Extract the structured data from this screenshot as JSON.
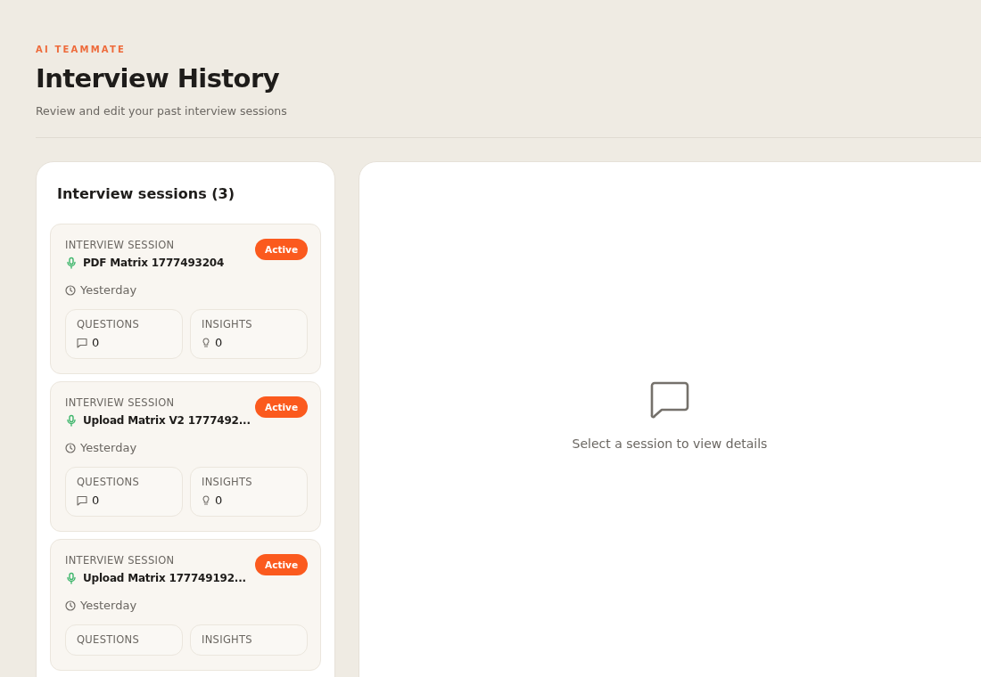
{
  "header": {
    "eyebrow": "AI TEAMMATE",
    "title": "Interview History",
    "subtitle": "Review and edit your past interview sessions"
  },
  "sessions_panel": {
    "heading": "Interview sessions (3)",
    "sessions": [
      {
        "label": "INTERVIEW SESSION",
        "title": "PDF Matrix 1777493204",
        "time": "Yesterday",
        "status": "Active",
        "stats": [
          {
            "kind": "questions",
            "label": "QUESTIONS",
            "value": "0"
          },
          {
            "kind": "insights",
            "label": "INSIGHTS",
            "value": "0"
          }
        ]
      },
      {
        "label": "INTERVIEW SESSION",
        "title": "Upload Matrix V2 1777492...",
        "time": "Yesterday",
        "status": "Active",
        "stats": [
          {
            "kind": "questions",
            "label": "QUESTIONS",
            "value": "0"
          },
          {
            "kind": "insights",
            "label": "INSIGHTS",
            "value": "0"
          }
        ]
      },
      {
        "label": "INTERVIEW SESSION",
        "title": "Upload Matrix 177749192...",
        "time": "Yesterday",
        "status": "Active",
        "stats": [
          {
            "kind": "questions",
            "label": "QUESTIONS"
          },
          {
            "kind": "insights",
            "label": "INSIGHTS"
          }
        ]
      }
    ]
  },
  "detail_panel": {
    "empty_message": "Select a session to view details"
  }
}
